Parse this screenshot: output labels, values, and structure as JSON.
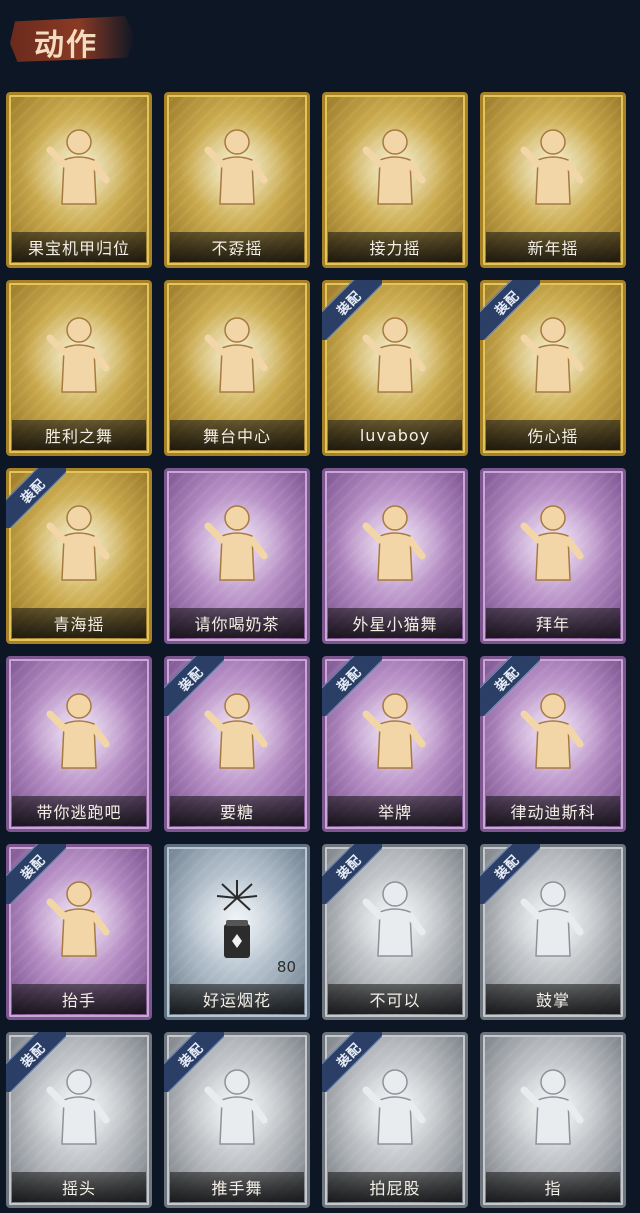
{
  "header": {
    "title": "动作"
  },
  "badge_label": "装配",
  "colors": {
    "gold": "#c9a94c",
    "purple": "#b58dc4",
    "gray": "#b4b8bc",
    "blue": "#a7b5c2",
    "badge": "#2b3f66",
    "background": "#0d1624"
  },
  "cards": [
    {
      "label": "果宝机甲归位",
      "rarity": "gold",
      "equipped": false,
      "icon": "dance-pose-icon"
    },
    {
      "label": "不孬摇",
      "rarity": "gold",
      "equipped": false,
      "icon": "dance-pose-icon"
    },
    {
      "label": "接力摇",
      "rarity": "gold",
      "equipped": false,
      "icon": "dance-pose-icon"
    },
    {
      "label": "新年摇",
      "rarity": "gold",
      "equipped": false,
      "icon": "dance-pose-icon"
    },
    {
      "label": "胜利之舞",
      "rarity": "gold",
      "equipped": false,
      "icon": "dance-pose-icon"
    },
    {
      "label": "舞台中心",
      "rarity": "gold",
      "equipped": false,
      "icon": "dance-pose-icon"
    },
    {
      "label": "luvaboy",
      "rarity": "gold",
      "equipped": true,
      "icon": "dance-pose-icon"
    },
    {
      "label": "伤心摇",
      "rarity": "gold",
      "equipped": true,
      "icon": "heart-pose-icon"
    },
    {
      "label": "青海摇",
      "rarity": "gold",
      "equipped": true,
      "icon": "dance-pose-icon"
    },
    {
      "label": "请你喝奶茶",
      "rarity": "purple",
      "equipped": false,
      "icon": "sign-pose-icon"
    },
    {
      "label": "外星小猫舞",
      "rarity": "purple",
      "equipped": false,
      "icon": "dance-pose-icon"
    },
    {
      "label": "拜年",
      "rarity": "purple",
      "equipped": false,
      "icon": "bow-pose-icon"
    },
    {
      "label": "带你逃跑吧",
      "rarity": "purple",
      "equipped": false,
      "icon": "point-pose-icon"
    },
    {
      "label": "要糖",
      "rarity": "purple",
      "equipped": true,
      "icon": "ask-pose-icon"
    },
    {
      "label": "举牌",
      "rarity": "purple",
      "equipped": true,
      "icon": "sign-pose-icon"
    },
    {
      "label": "律动迪斯科",
      "rarity": "purple",
      "equipped": true,
      "icon": "disco-pose-icon"
    },
    {
      "label": "抬手",
      "rarity": "purple",
      "equipped": true,
      "icon": "raise-hand-icon"
    },
    {
      "label": "好运烟花",
      "rarity": "blue",
      "equipped": false,
      "icon": "firework-icon",
      "count": "80"
    },
    {
      "label": "不可以",
      "rarity": "gray",
      "equipped": true,
      "icon": "finger-no-icon"
    },
    {
      "label": "鼓掌",
      "rarity": "gray",
      "equipped": true,
      "icon": "clap-icon"
    },
    {
      "label": "摇头",
      "rarity": "gray",
      "equipped": true,
      "icon": "shake-head-icon"
    },
    {
      "label": "推手舞",
      "rarity": "gray",
      "equipped": true,
      "icon": "push-hand-icon"
    },
    {
      "label": "拍屁股",
      "rarity": "gray",
      "equipped": true,
      "icon": "slap-pose-icon"
    },
    {
      "label": "指",
      "rarity": "gray",
      "equipped": false,
      "icon": "point-hand-icon"
    }
  ]
}
